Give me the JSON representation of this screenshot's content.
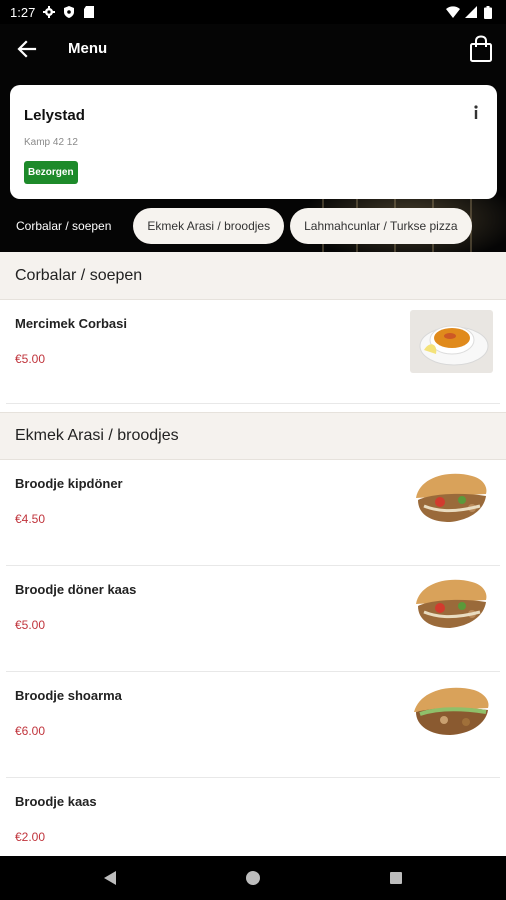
{
  "status_bar": {
    "time": "1:27",
    "icons": [
      "gear-icon",
      "shield-icon",
      "sd-card-icon",
      "wifi-icon",
      "signal-icon",
      "battery-icon"
    ]
  },
  "app_bar": {
    "title": "Menu",
    "back_icon": "arrow-left-icon",
    "cart_icon": "shopping-bag-icon"
  },
  "store": {
    "name": "Lelystad",
    "address": "Kamp 42 12",
    "badge": "Bezorgen",
    "info_icon": "info-icon"
  },
  "tabs": [
    {
      "label": "Corbalar / soepen",
      "active": true
    },
    {
      "label": "Ekmek Arasi / broodjes",
      "active": false
    },
    {
      "label": "Lahmahcunlar / Turkse pizza",
      "active": false
    }
  ],
  "sections": [
    {
      "title": "Corbalar / soepen",
      "items": [
        {
          "name": "Mercimek Corbasi",
          "price": "€5.00",
          "image": "lentil-soup"
        }
      ]
    },
    {
      "title": "Ekmek Arasi / broodjes",
      "items": [
        {
          "name": "Broodje kipdöner",
          "price": "€4.50",
          "image": "doner-sandwich"
        },
        {
          "name": "Broodje döner kaas",
          "price": "€5.00",
          "image": "doner-sandwich"
        },
        {
          "name": "Broodje shoarma",
          "price": "€6.00",
          "image": "doner-sandwich"
        },
        {
          "name": "Broodje kaas",
          "price": "€2.00",
          "image": ""
        }
      ]
    }
  ],
  "colors": {
    "price": "#c0343c",
    "badge": "#1d8a2a",
    "section_bg": "#f5f2ee"
  }
}
